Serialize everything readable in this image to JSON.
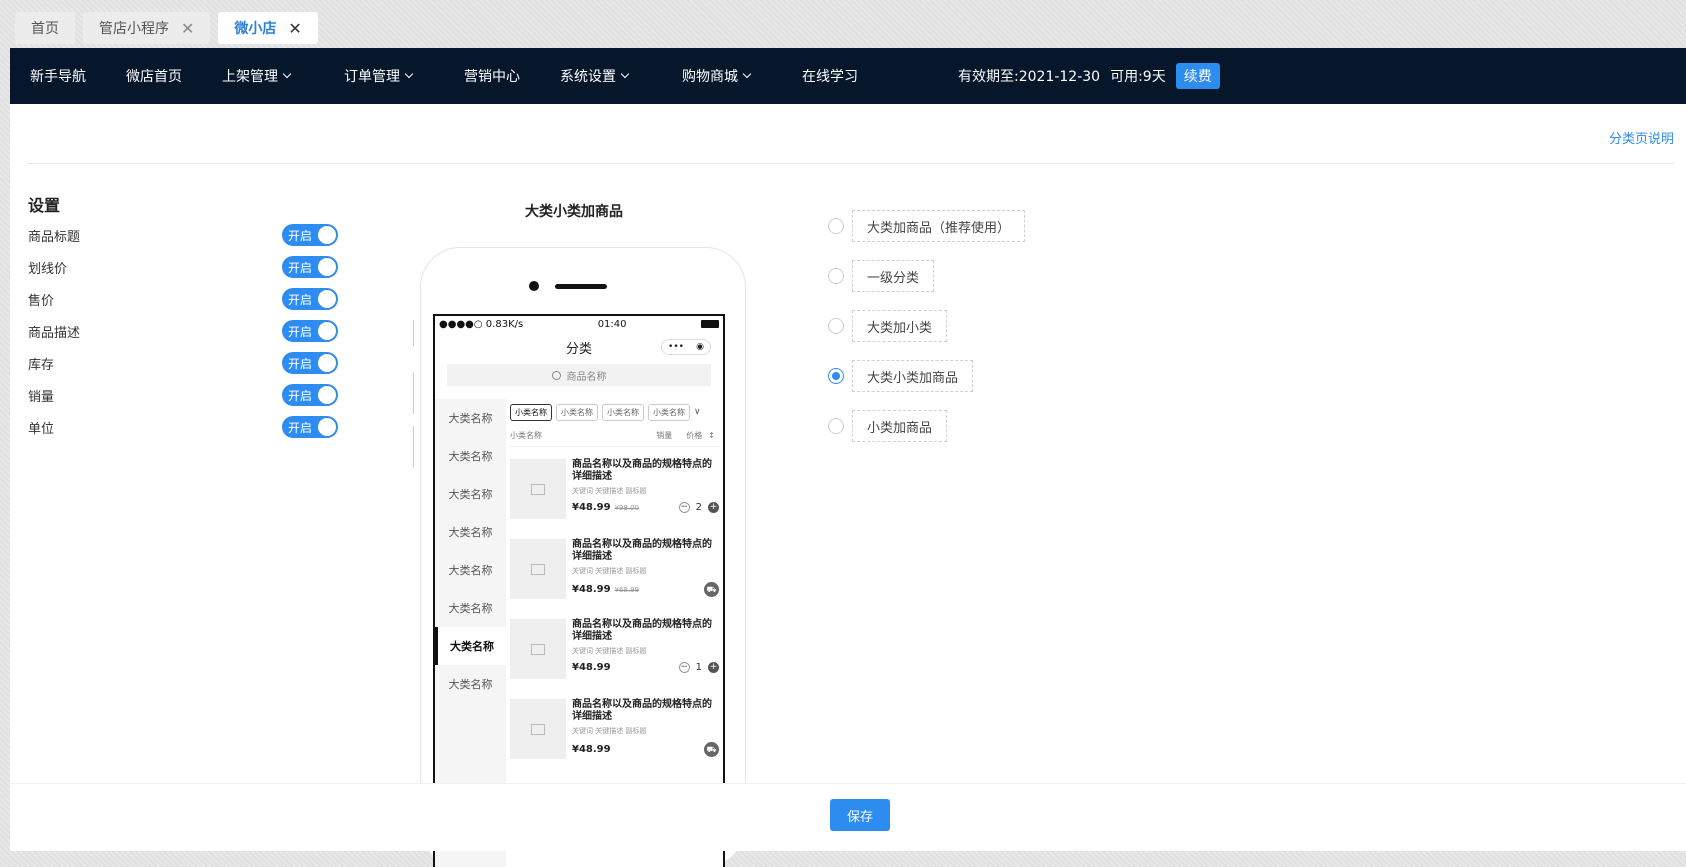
{
  "tabs": [
    {
      "label": "首页",
      "closable": false
    },
    {
      "label": "管店小程序",
      "closable": true
    },
    {
      "label": "微小店",
      "closable": true,
      "active": true
    }
  ],
  "nav": {
    "items": [
      "新手导航",
      "微店首页",
      "上架管理",
      "订单管理",
      "营销中心",
      "系统设置",
      "购物商城",
      "在线学习"
    ],
    "expiry": "有效期至:2021-12-30",
    "available": "可用:9天",
    "renew": "续费"
  },
  "explain_link": "分类页说明",
  "settings": {
    "title": "设置",
    "rows": [
      {
        "label": "商品标题",
        "switch": "开启"
      },
      {
        "label": "划线价",
        "switch": "开启"
      },
      {
        "label": "售价",
        "switch": "开启"
      },
      {
        "label": "商品描述",
        "switch": "开启"
      },
      {
        "label": "库存",
        "switch": "开启"
      },
      {
        "label": "销量",
        "switch": "开启"
      },
      {
        "label": "单位",
        "switch": "开启"
      }
    ]
  },
  "preview": {
    "title": "大类小类加商品",
    "status": {
      "signal": "●●●●○ 0.83K/s",
      "time": "01:40"
    },
    "page_title": "分类",
    "capsule_dots": "•••",
    "capsule_target": "◉",
    "search_placeholder": "商品名称",
    "categories": [
      "大类名称",
      "大类名称",
      "大类名称",
      "大类名称",
      "大类名称",
      "大类名称",
      "大类名称",
      "大类名称"
    ],
    "active_category_index": 6,
    "subcategories": [
      "小类名称",
      "小类名称",
      "小类名称",
      "小类名称"
    ],
    "sort": {
      "name": "小类名称",
      "sales": "销量",
      "price": "价格",
      "arrow": "↕"
    },
    "goods": [
      {
        "name": "商品名称以及商品的规格特点的详细描述",
        "tags": "关键词  关键描述  副标题",
        "price": "¥48.99",
        "old": "¥98.00",
        "qty": "2"
      },
      {
        "name": "商品名称以及商品的规格特点的详细描述",
        "tags": "关键词  关键描述  副标题",
        "price": "¥48.99",
        "old": "¥68.99",
        "qty": ""
      },
      {
        "name": "商品名称以及商品的规格特点的详细描述",
        "tags": "关键词  关键描述  副标题",
        "price": "¥48.99",
        "old": "",
        "qty": "1"
      },
      {
        "name": "商品名称以及商品的规格特点的详细描述",
        "tags": "关键词  关键描述  副标题",
        "price": "¥48.99",
        "old": "",
        "qty": ""
      }
    ]
  },
  "layout_options": [
    {
      "label": "大类加商品（推荐使用）",
      "checked": false
    },
    {
      "label": "一级分类",
      "checked": false
    },
    {
      "label": "大类加小类",
      "checked": false
    },
    {
      "label": "大类小类加商品",
      "checked": true
    },
    {
      "label": "小类加商品",
      "checked": false
    }
  ],
  "save_label": "保存",
  "colors": {
    "nav_bg": "#06162b",
    "accent": "#2d8cf0"
  }
}
